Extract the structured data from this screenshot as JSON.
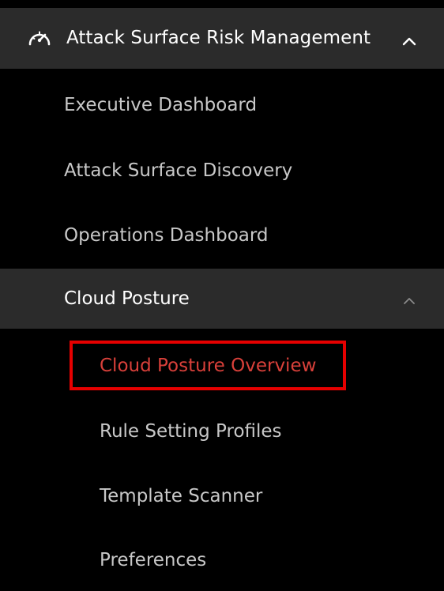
{
  "colors": {
    "background": "#000000",
    "header_background": "#2b2b2b",
    "text_primary": "#ffffff",
    "text_secondary": "#c8c8c8",
    "active_text": "#d9403a",
    "highlight_border": "#e60000"
  },
  "section": {
    "icon": "speedometer-icon",
    "title": "Attack Surface Risk Management",
    "expanded": true,
    "chevron_icon": "chevron-up-icon"
  },
  "items": [
    {
      "label": "Executive Dashboard"
    },
    {
      "label": "Attack Surface Discovery"
    },
    {
      "label": "Operations Dashboard"
    }
  ],
  "subsection": {
    "title": "Cloud Posture",
    "expanded": true,
    "chevron_icon": "chevron-up-icon",
    "items": [
      {
        "label": "Cloud Posture Overview",
        "active": true,
        "highlighted": true
      },
      {
        "label": "Rule Setting Profiles"
      },
      {
        "label": "Template Scanner"
      },
      {
        "label": "Preferences"
      }
    ]
  }
}
